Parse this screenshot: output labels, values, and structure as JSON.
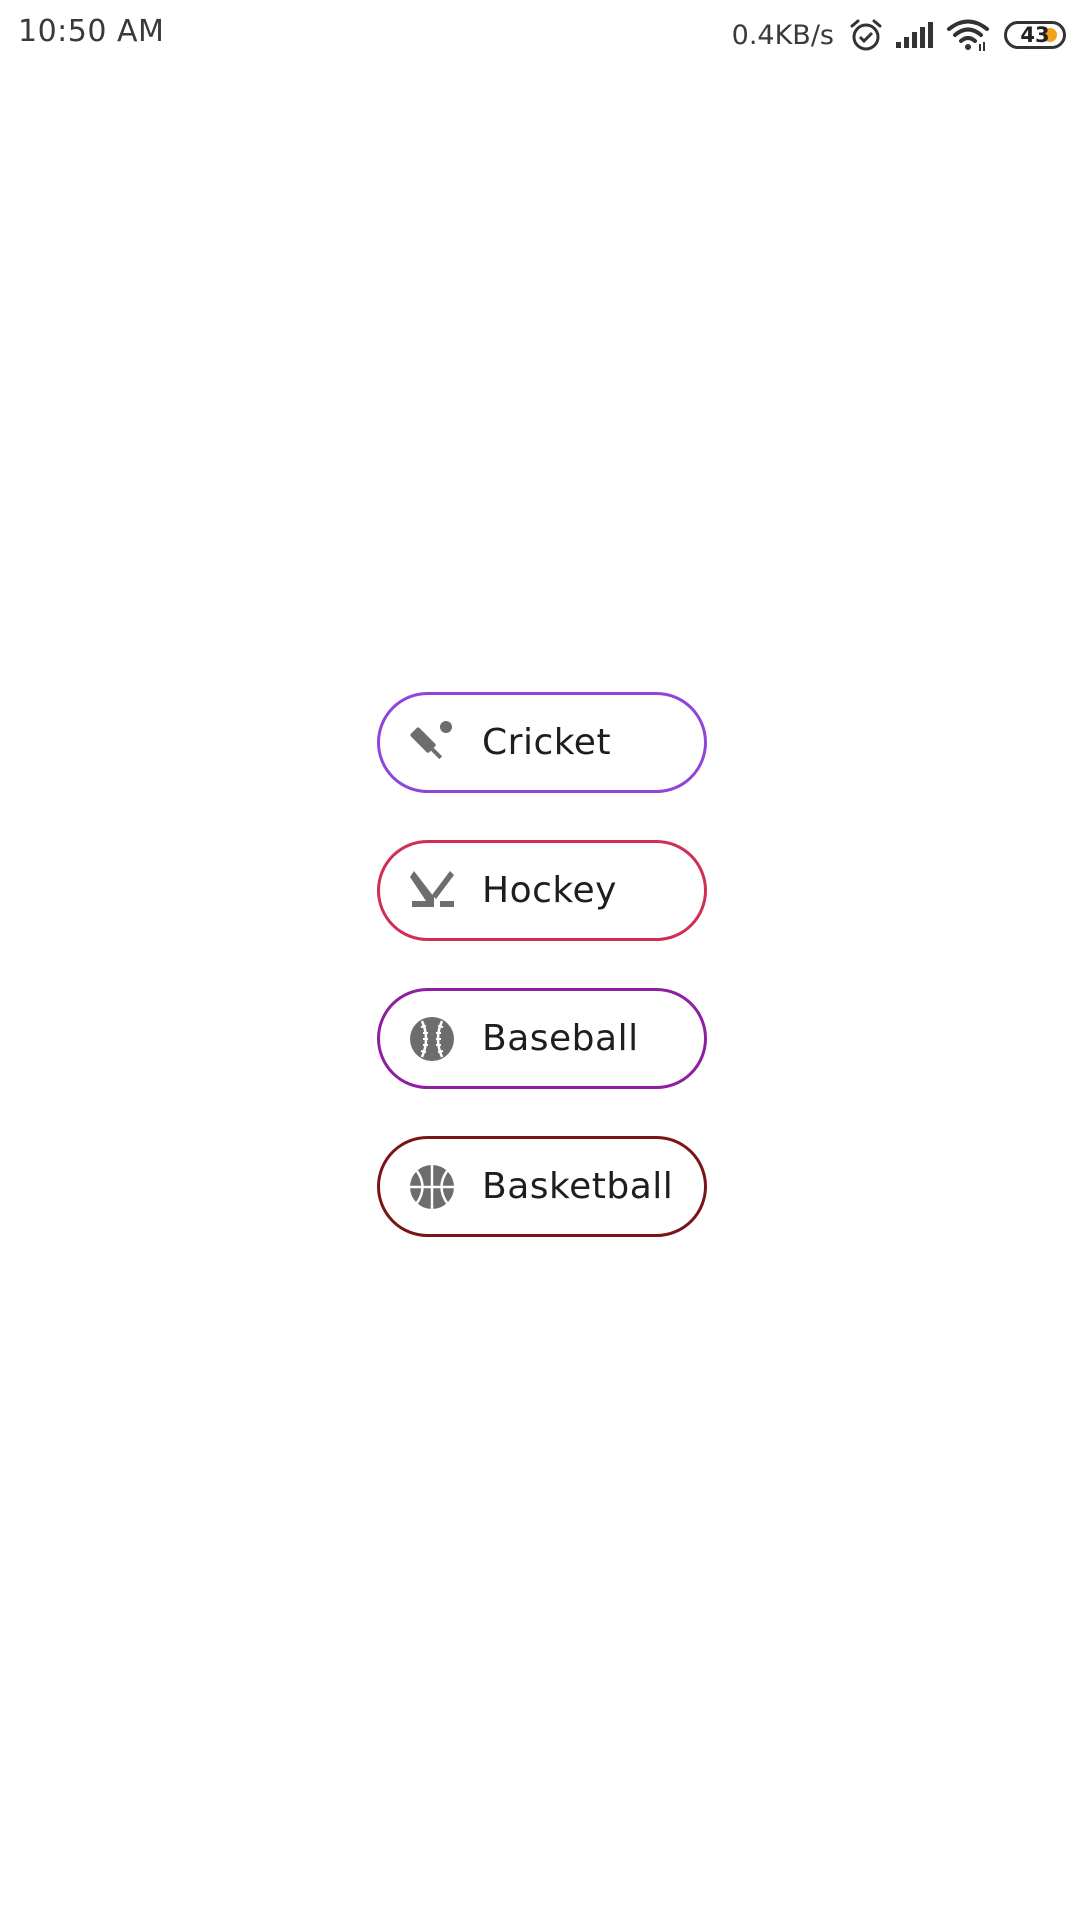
{
  "status_bar": {
    "time": "10:50 AM",
    "net_speed": "0.4KB/s",
    "battery_level": "43"
  },
  "sports": [
    {
      "label": "Cricket",
      "icon": "cricket-icon",
      "border_color": "#9045d8"
    },
    {
      "label": "Hockey",
      "icon": "hockey-icon",
      "border_color": "#d02f55"
    },
    {
      "label": "Baseball",
      "icon": "baseball-icon",
      "border_color": "#8e1fa0"
    },
    {
      "label": "Basketball",
      "icon": "basketball-icon",
      "border_color": "#7a1418"
    }
  ]
}
